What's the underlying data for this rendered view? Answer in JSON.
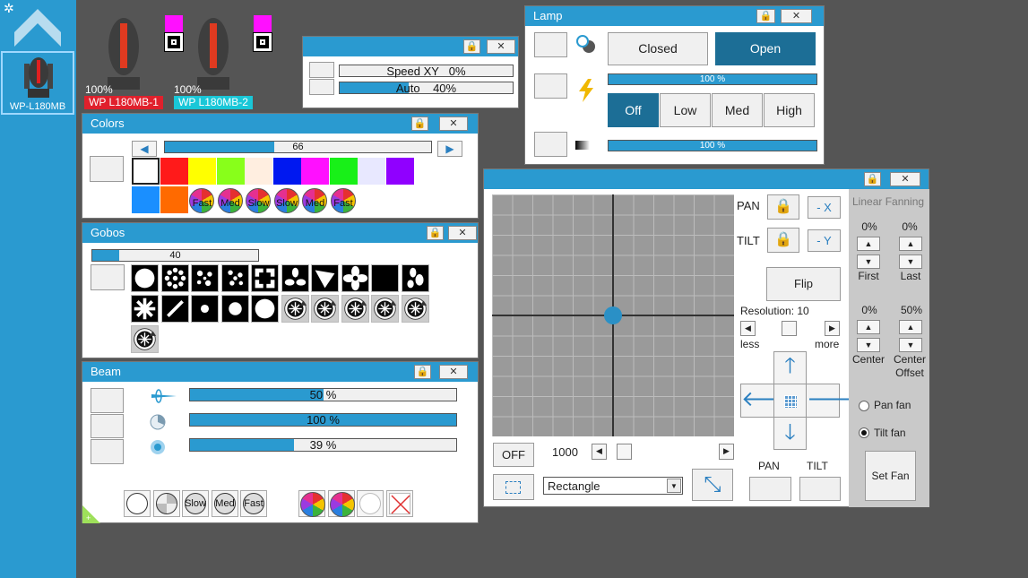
{
  "sidebar": {
    "fixture_label": "WP-L180MB"
  },
  "fixtures": [
    {
      "dimmer": "100%",
      "name": "WP L180MB-1",
      "name_color": "#e0202c"
    },
    {
      "dimmer": "100%",
      "name": "WP L180MB-2",
      "name_color": "#19c7d8"
    }
  ],
  "speed_panel": {
    "speed_label": "Speed XY",
    "speed_value": "0%",
    "auto_label": "Auto",
    "auto_value": "40%",
    "auto_fraction": 0.4
  },
  "colors": {
    "title": "Colors",
    "slider_value": "66",
    "slider_fraction": 0.41,
    "swatches": [
      "#ffffff",
      "#ff1a1a",
      "#ffff00",
      "#88ff1a",
      "#ffeee0",
      "#0018f0",
      "#ff10ff",
      "#18f018",
      "#e8e8ff",
      "#9000ff",
      "#1a8fff",
      "#ff6a00"
    ],
    "wheel_labels": [
      "Fast",
      "Med",
      "Slow",
      "Slow",
      "Med",
      "Fast"
    ]
  },
  "gobos": {
    "title": "Gobos",
    "slider_value": "40",
    "slider_fraction": 0.16
  },
  "beam": {
    "title": "Beam",
    "rows": [
      {
        "value": "50 %",
        "fraction": 0.5
      },
      {
        "value": "100 %",
        "fraction": 1.0
      },
      {
        "value": "39 %",
        "fraction": 0.39
      }
    ],
    "bottom_labels": [
      "Slow",
      "Med",
      "Fast"
    ]
  },
  "lamp": {
    "title": "Lamp",
    "closed": "Closed",
    "open": "Open",
    "bar1": "100 %",
    "power": [
      "Off",
      "Low",
      "Med",
      "High"
    ],
    "bar2": "100 %"
  },
  "pantilt": {
    "pan_label": "PAN",
    "tilt_label": "TILT",
    "x_button": "- X",
    "y_button": "- Y",
    "flip": "Flip",
    "resolution": "Resolution: 10",
    "less": "less",
    "more": "more",
    "off": "OFF",
    "speed_value": "1000",
    "shape": "Rectangle",
    "pan_bottom": "PAN",
    "tilt_bottom": "TILT"
  },
  "fanning": {
    "title": "Linear Fanning",
    "first_pct": "0%",
    "last_pct": "0%",
    "first": "First",
    "last": "Last",
    "center_pct": "0%",
    "center_offset_pct": "50%",
    "center": "Center",
    "center_offset_1": "Center",
    "center_offset_2": "Offset",
    "pan_fan": "Pan fan",
    "tilt_fan": "Tilt fan",
    "set_fan": "Set Fan"
  },
  "colors_theme": {
    "accent": "#2a9ad0",
    "background": "#555555"
  }
}
